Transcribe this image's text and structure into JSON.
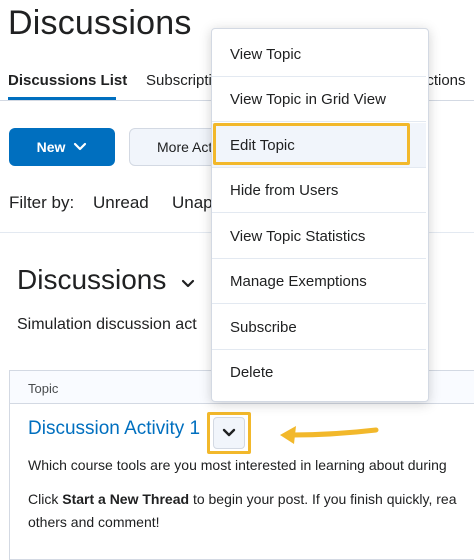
{
  "page": {
    "title": "Discussions"
  },
  "tabs": [
    {
      "label": "Discussions List"
    },
    {
      "label": "Subscripti"
    },
    {
      "label": "ictions"
    }
  ],
  "toolbar": {
    "new_label": "New",
    "more_label": "More Act"
  },
  "filter": {
    "label": "Filter by:",
    "options": [
      "Unread",
      "Unap"
    ]
  },
  "section": {
    "heading": "Discussions",
    "description": "Simulation discussion act"
  },
  "table": {
    "header": "Topic",
    "row": {
      "topic": "Discussion Activity 1",
      "line1": "Which course tools are you most interested in learning about during",
      "line2_pre": "Click ",
      "line2_bold": "Start a New Thread",
      "line2_post": " to begin your post. If you finish quickly, rea",
      "line3": "others and comment!"
    }
  },
  "context_menu": {
    "items": [
      "View Topic",
      "View Topic in Grid View",
      "Edit Topic",
      "Hide from Users",
      "View Topic Statistics",
      "Manage Exemptions",
      "Subscribe",
      "Delete"
    ]
  },
  "colors": {
    "accent": "#006fbf",
    "highlight": "#f2b82b"
  }
}
